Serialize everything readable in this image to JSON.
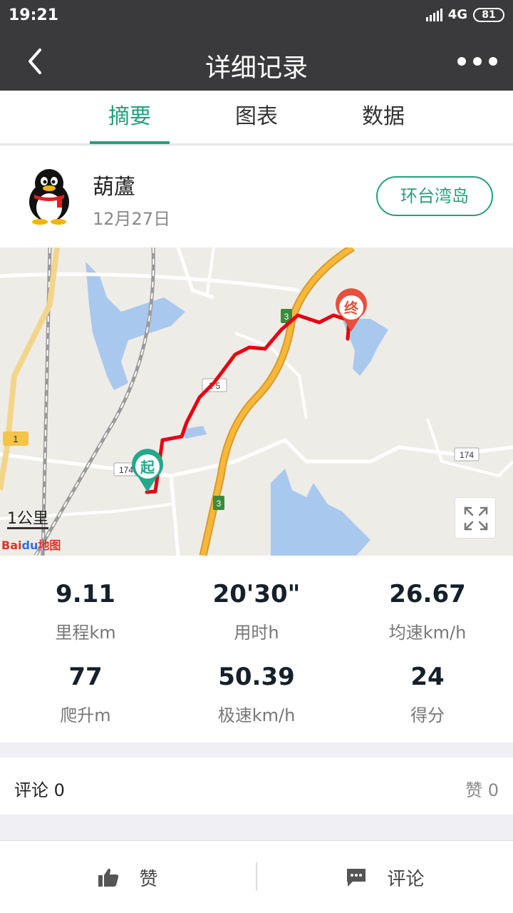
{
  "status_bar": {
    "time": "19:21",
    "network": "4G",
    "battery": "81"
  },
  "nav": {
    "title": "详细记录"
  },
  "tabs": [
    {
      "label": "摘要",
      "active": true
    },
    {
      "label": "图表",
      "active": false
    },
    {
      "label": "数据",
      "active": false
    }
  ],
  "user": {
    "name": "葫蘆",
    "date": "12月27日",
    "route_tag": "环台湾岛"
  },
  "map": {
    "scale_label": "1公里",
    "start_marker": "起",
    "end_marker": "终",
    "road_labels": [
      "1",
      "3",
      "3",
      "174",
      "174",
      "1 5"
    ],
    "logo_text_1": "Bai",
    "logo_text_2": "du",
    "logo_text_3": "地图",
    "route_color": "#e60012"
  },
  "stats": [
    {
      "value": "9.11",
      "label": "里程km"
    },
    {
      "value": "20'30\"",
      "label": "用时h"
    },
    {
      "value": "26.67",
      "label": "均速km/h"
    },
    {
      "value": "77",
      "label": "爬升m"
    },
    {
      "value": "50.39",
      "label": "极速km/h"
    },
    {
      "value": "24",
      "label": "得分"
    }
  ],
  "comments": {
    "comment_label": "评论 0",
    "like_label": "赞 0"
  },
  "bottom_bar": {
    "like_button": "赞",
    "comment_button": "评论"
  },
  "colors": {
    "accent": "#22a27c",
    "header_bg": "#3a3a3c"
  }
}
